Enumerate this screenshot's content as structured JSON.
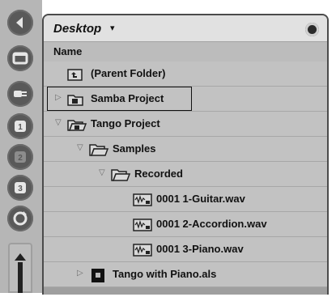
{
  "browser": {
    "location": "Desktop",
    "location_caret": "▾",
    "column_header": "Name"
  },
  "sidebar": {
    "buttons": [
      {
        "name": "collapse-browser-icon"
      },
      {
        "name": "file-browser-1-icon"
      },
      {
        "name": "plugin-devices-icon"
      },
      {
        "name": "browser-1-icon"
      },
      {
        "name": "browser-2-icon"
      },
      {
        "name": "browser-3-icon"
      },
      {
        "name": "refresh-icon"
      }
    ]
  },
  "tree": [
    {
      "label": "(Parent Folder)",
      "indent": 0,
      "expander": "",
      "icon": "parent-folder-icon"
    },
    {
      "label": "Samba Project",
      "indent": 0,
      "expander": "▷",
      "icon": "project-folder-icon"
    },
    {
      "label": "Tango Project",
      "indent": 0,
      "expander": "▽",
      "icon": "project-folder-open-icon"
    },
    {
      "label": "Samples",
      "indent": 1,
      "expander": "▽",
      "icon": "folder-open-icon"
    },
    {
      "label": "Recorded",
      "indent": 2,
      "expander": "▽",
      "icon": "folder-open-icon"
    },
    {
      "label": "0001 1-Guitar.wav",
      "indent": 3,
      "expander": "",
      "icon": "audio-file-icon"
    },
    {
      "label": "0001 2-Accordion.wav",
      "indent": 3,
      "expander": "",
      "icon": "audio-file-icon"
    },
    {
      "label": "0001 3-Piano.wav",
      "indent": 3,
      "expander": "",
      "icon": "audio-file-icon"
    },
    {
      "label": "Tango with Piano.als",
      "indent": 1,
      "expander": "▷",
      "icon": "live-set-icon"
    }
  ]
}
